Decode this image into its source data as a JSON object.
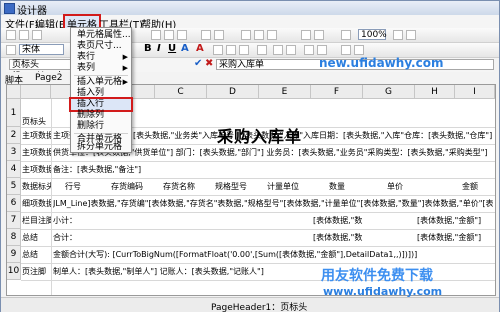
{
  "window": {
    "title": "设计器"
  },
  "menubar": {
    "file": "文件(F)",
    "edit": "编辑(E)",
    "cell": "单元格",
    "tools": "工具栏(T)",
    "help": "帮助(H)"
  },
  "toolbar": {
    "font": "宋体",
    "zoom": "100%"
  },
  "formula": {
    "cell_ref": "页标头(PageHeader1)",
    "content": "采购入库单"
  },
  "tabs": {
    "t1": "脚本",
    "t2": "Page2"
  },
  "menu": {
    "items": [
      "单元格属性...",
      "表页尺寸...",
      "表行",
      "表列",
      "插入单元格",
      "插入列",
      "插入行",
      "删除列",
      "删除行",
      "合并单元格",
      "拆分单元格"
    ]
  },
  "columns": [
    "A",
    "B",
    "C",
    "D",
    "E",
    "F",
    "G",
    "H",
    "I"
  ],
  "rows": [
    {
      "n": "1",
      "label": "页标头"
    },
    {
      "n": "2",
      "label": "主项数据"
    },
    {
      "n": "3",
      "label": "主项数据"
    },
    {
      "n": "4",
      "label": "主项数据"
    },
    {
      "n": "5",
      "label": "数据标头"
    },
    {
      "n": "6",
      "label": "细项数据"
    },
    {
      "n": "7",
      "label": "栏目注脚"
    },
    {
      "n": "8",
      "label": "总结"
    },
    {
      "n": "9",
      "label": "总结"
    },
    {
      "n": "10",
      "label": "页注脚"
    }
  ],
  "sheet": {
    "title": "采购入库单",
    "r2": "主项数据：业务类型：[表头数据,\"业务类\"入库单号：[表头数据,\"入库\"入库日期：[表头数据,\"入库\"仓库：[表头数据,\"仓库\"]",
    "r3": "供货单位：[表头数据,\"供货单位\"]  部门：[表头数据,\"部门\"]   业务员：[表头数据,\"业务员\"采购类型：[表头数据,\"采购类型\"]",
    "r4": "备注：[表头数据,\"备注\"]",
    "r5": [
      "行号",
      "存货编码",
      "存货名称",
      "规格型号",
      "计量单位",
      "数量",
      "单价",
      "金额"
    ],
    "r6": "JLM_Line]表数据,\"存货编\"[表体数据,\"存货名\"表数据,\"规格型号\"[表体数据,\"计量单位\"[表体数据,\"数量\"]表体数据,\"单价\"[表体数据,\"金额\"]",
    "r7": [
      "小计：",
      "[表体数据,\"数",
      "[表体数据,\"金额\"]"
    ],
    "r8": [
      "合计：",
      "[表体数据,\"数",
      "[表体数据,\"金额\"]"
    ],
    "r9": "金额合计(大写): [CurrToBigNum([FormatFloat('0.00',[Sum([表体数据,\"金额\"],DetailData1,,)])])]",
    "r10": "制单人：[表头数据,\"制单人\"] 记账人：[表头数据,\"记账人\"]"
  },
  "status": {
    "center": "PageHeader1：页标头"
  },
  "watermarks": {
    "w1": "new.ufidawhy.com",
    "w2": "用友软件免费下载",
    "w3": "www.ufidawhy.com"
  }
}
